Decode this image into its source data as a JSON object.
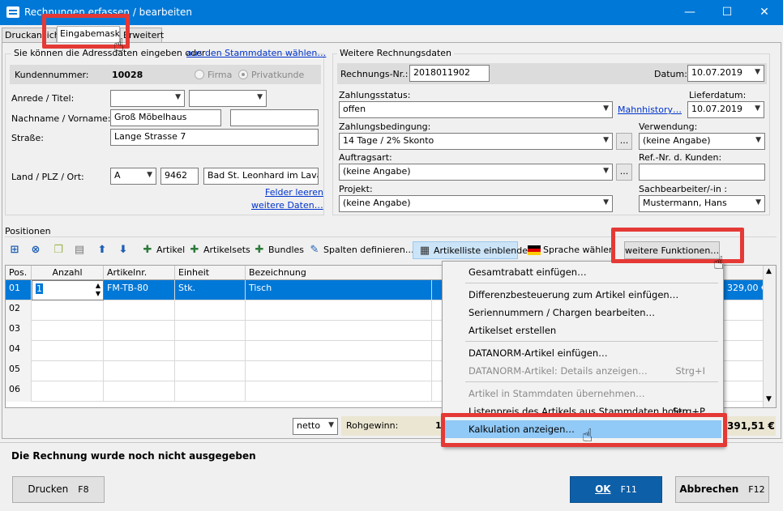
{
  "window": {
    "title": "Rechnungen erfassen / bearbeiten",
    "minimize": "—",
    "maximize": "☐",
    "close": "✕"
  },
  "tabs": [
    "Druckansicht",
    "Eingabemaske",
    "Erweitert"
  ],
  "address": {
    "intro": "Sie können die Adressdaten eingeben oder",
    "link": "aus den Stammdaten wählen…",
    "customer_no_label": "Kundennummer:",
    "customer_no": "10028",
    "radio_firma": "Firma",
    "radio_privat": "Privatkunde",
    "salutation_label": "Anrede / Titel:",
    "name_label": "Nachname / Vorname:",
    "lastname": "Groß Möbelhaus",
    "firstname": "",
    "street_label": "Straße:",
    "street": "Lange Strasse 7",
    "country_label": "Land / PLZ / Ort:",
    "country": "A",
    "zip": "9462",
    "city": "Bad St. Leonhard im Lavantt",
    "clear_link": "Felder leeren",
    "more_link": "weitere Daten…"
  },
  "invoice": {
    "group_title": "Weitere Rechnungsdaten",
    "number_label": "Rechnungs-Nr.:",
    "number": "2018011902",
    "date_label": "Datum:",
    "date": "10.07.2019",
    "status_label": "Zahlungsstatus:",
    "status": "offen",
    "dunning_link": "Mahnhistory…",
    "delivery_label": "Lieferdatum:",
    "delivery": "10.07.2019",
    "terms_label": "Zahlungsbedingung:",
    "terms": "14 Tage / 2% Skonto",
    "usage_label": "Verwendung:",
    "usage": "(keine Angabe)",
    "order_type_label": "Auftragsart:",
    "order_type": "(keine Angabe)",
    "ref_label": "Ref.-Nr. d. Kunden:",
    "ref": "",
    "project_label": "Projekt:",
    "project": "(keine Angabe)",
    "clerk_label": "Sachbearbeiter/-in :",
    "clerk": "Mustermann, Hans",
    "dots": "..."
  },
  "positions": {
    "title": "Positionen",
    "toolbar": {
      "artikel": "Artikel",
      "artikelsets": "Artikelsets",
      "bundles": "Bundles",
      "columns": "Spalten definieren…",
      "list": "Artikelliste einblenden",
      "language": "Sprache wählen",
      "more": "weitere Funktionen…"
    },
    "headers": [
      "Pos.",
      "Anzahl",
      "Artikelnr.",
      "Einheit",
      "Bezeichnung"
    ],
    "rows": [
      {
        "pos": "01",
        "qty": "1",
        "nr": "FM-TB-80",
        "unit": "Stk.",
        "desc": "Tisch",
        "total": "329,00 €"
      },
      {
        "pos": "02"
      },
      {
        "pos": "03"
      },
      {
        "pos": "04"
      },
      {
        "pos": "05"
      },
      {
        "pos": "06"
      }
    ]
  },
  "menu": [
    {
      "label": "Gesamtrabatt einfügen…",
      "shortcut": "",
      "disabled": false
    },
    {
      "label": "Differenzbesteuerung zum Artikel einfügen…",
      "shortcut": "",
      "disabled": false
    },
    {
      "label": "Seriennummern / Chargen bearbeiten…",
      "shortcut": "",
      "disabled": false
    },
    {
      "label": "Artikelset erstellen",
      "shortcut": "",
      "disabled": false
    },
    {
      "label": "DATANORM-Artikel einfügen…",
      "shortcut": "",
      "disabled": false
    },
    {
      "label": "DATANORM-Artikel: Details anzeigen…",
      "shortcut": "Strg+I",
      "disabled": true
    },
    {
      "label": "Artikel in Stammdaten übernehmen…",
      "shortcut": "",
      "disabled": true
    },
    {
      "label": "Listenpreis des Artikels aus Stammdaten holen",
      "shortcut": "Strg+P",
      "disabled": false
    },
    {
      "label": "Kalkulation anzeigen…",
      "shortcut": "",
      "disabled": false
    }
  ],
  "footer": {
    "netto": "netto",
    "rohgewinn_label": "Rohgewinn:",
    "rohgewinn_partial": "1",
    "total": "391,51 €",
    "status": "Die Rechnung wurde noch nicht ausgegeben",
    "print": "Drucken",
    "print_key": "F8",
    "ok": "OK",
    "ok_key": "F11",
    "cancel": "Abbrechen",
    "cancel_key": "F12"
  }
}
